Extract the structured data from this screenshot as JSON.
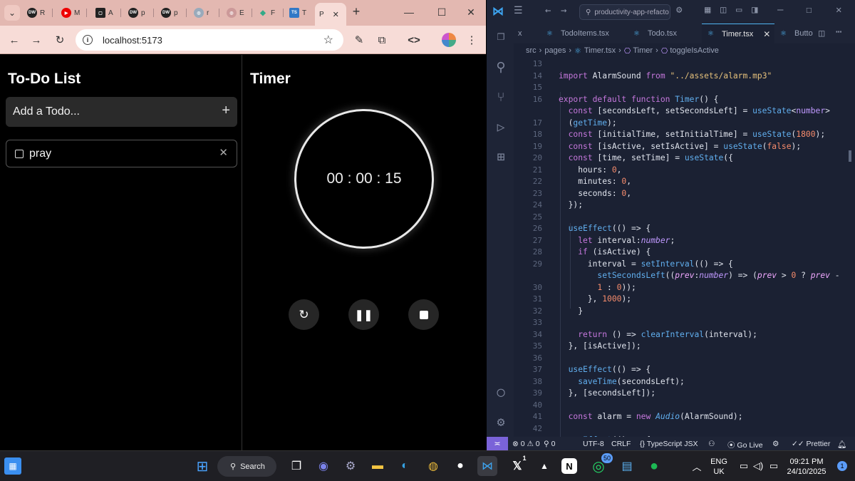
{
  "browser": {
    "tabs": [
      {
        "fav": "DW",
        "label": "R"
      },
      {
        "fav": "▶",
        "label": "M"
      },
      {
        "fav": "▢",
        "label": "A"
      },
      {
        "fav": "DW",
        "label": "p"
      },
      {
        "fav": "DW",
        "label": "p"
      },
      {
        "fav": "◎",
        "label": "r"
      },
      {
        "fav": "◎",
        "label": "E"
      },
      {
        "fav": "◆",
        "label": "F"
      },
      {
        "fav": "TS",
        "label": "T"
      },
      {
        "fav": "",
        "label": "P"
      }
    ],
    "url": "localhost:5173"
  },
  "todo": {
    "title": "To-Do List",
    "add_placeholder": "Add a Todo...",
    "items": [
      {
        "text": "pray",
        "done": false
      }
    ]
  },
  "timer": {
    "title": "Timer",
    "display": "00 : 00 : 15"
  },
  "vscode": {
    "search": "productivity-app-refacto",
    "tabs": [
      "x",
      "TodoItems.tsx",
      "Todo.tsx",
      "Timer.tsx",
      "Butto"
    ],
    "breadcrumb": [
      "src",
      "pages",
      "Timer.tsx",
      "Timer",
      "toggleIsActive"
    ],
    "line_numbers": [
      "13",
      "14",
      "15",
      "16",
      "",
      "17",
      "18",
      "19",
      "20",
      "21",
      "22",
      "23",
      "24",
      "25",
      "26",
      "27",
      "28",
      "29",
      "",
      "30",
      "31",
      "32",
      "33",
      "34",
      "35",
      "36",
      "37",
      "38",
      "39",
      "40",
      "41",
      "42"
    ],
    "status": {
      "problems": "⊗ 0 ⚠ 0",
      "watch": "0",
      "encoding": "UTF-8",
      "eol": "CRLF",
      "language": "TypeScript JSX",
      "golive": "Go Live",
      "prettier": "Prettier"
    }
  },
  "taskbar": {
    "search_label": "Search",
    "x_badge": "1",
    "whatsapp_badge": "50",
    "lang_top": "ENG",
    "lang_bottom": "UK",
    "time": "09:21 PM",
    "date": "24/10/2025",
    "notifications": "1"
  }
}
